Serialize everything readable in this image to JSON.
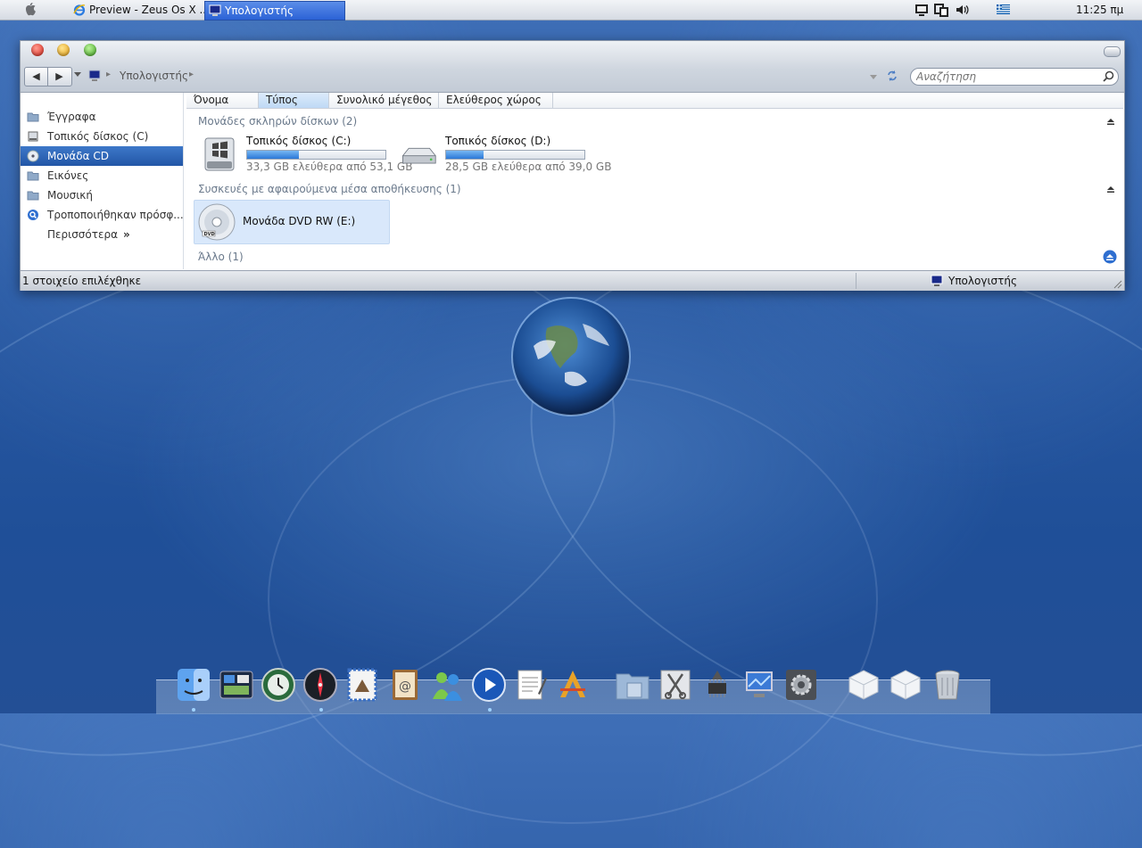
{
  "menubar": {
    "apple_icon": "apple-icon",
    "tasks": [
      {
        "label": "Preview - Zeus Os X ...",
        "icon": "internet-explorer-icon",
        "active": false
      },
      {
        "label": "Υπολογιστής",
        "icon": "computer-icon",
        "active": true
      }
    ],
    "tray_icons": [
      "monitor-icon",
      "windows-icon",
      "volume-icon",
      "greek-flag-icon"
    ],
    "clock": "11:25 πμ"
  },
  "window": {
    "breadcrumb": "Υπολογιστής",
    "search_placeholder": "Αναζήτηση",
    "sidebar": [
      {
        "label": "Έγγραφα",
        "icon": "folder-icon"
      },
      {
        "label": "Τοπικός δίσκος (C)",
        "icon": "hard-drive-icon"
      },
      {
        "label": "Μονάδα CD",
        "icon": "cd-icon",
        "selected": true
      },
      {
        "label": "Εικόνες",
        "icon": "folder-icon"
      },
      {
        "label": "Μουσική",
        "icon": "folder-icon"
      },
      {
        "label": "Τροποποιήθηκαν πρόσφ...",
        "icon": "search-folder-icon"
      },
      {
        "label": "Περισσότερα",
        "icon": "chevrons-icon"
      }
    ],
    "columns": [
      "Όνομα",
      "Τύπος",
      "Συνολικό μέγεθος",
      "Ελεύθερος χώρος"
    ],
    "sorted_column": "Τύπος",
    "groups": {
      "hard_drives": "Μονάδες σκληρών δίσκων (2)",
      "removable": "Συσκευές με αφαιρούμενα μέσα αποθήκευσης (1)",
      "other": "Άλλο (1)"
    },
    "drives": [
      {
        "name": "Τοπικός δίσκος (C:)",
        "free_text": "33,3 GB ελεύθερα από 53,1 GB",
        "used_fraction": 0.373,
        "icon": "windows-drive-icon"
      },
      {
        "name": "Τοπικός δίσκος (D:)",
        "free_text": "28,5 GB ελεύθερα από 39,0 GB",
        "used_fraction": 0.269,
        "icon": "hard-drive-icon"
      }
    ],
    "dvd": {
      "name": "Μονάδα DVD RW (E:)",
      "icon": "dvd-icon"
    },
    "status": {
      "selection": "1 στοιχείο επιλέχθηκε",
      "location": "Υπολογιστής"
    }
  },
  "colors": {
    "accent": "#2256a6",
    "selection_bg": "#d9e8fb",
    "bar_fill": "#2b78d8"
  },
  "dock": [
    "finder-icon",
    "dashboard-icon",
    "time-machine-icon",
    "safari-compass-icon",
    "mail-stamp-icon",
    "address-book-icon",
    "messenger-icon",
    "media-player-icon",
    "textedit-icon",
    "app-store-icon",
    "applications-folder-icon",
    "utilities-icon",
    "system-profiler-icon",
    "network-icon",
    "system-preferences-icon",
    "white-cube-icon",
    "white-cube-icon",
    "trash-icon"
  ]
}
